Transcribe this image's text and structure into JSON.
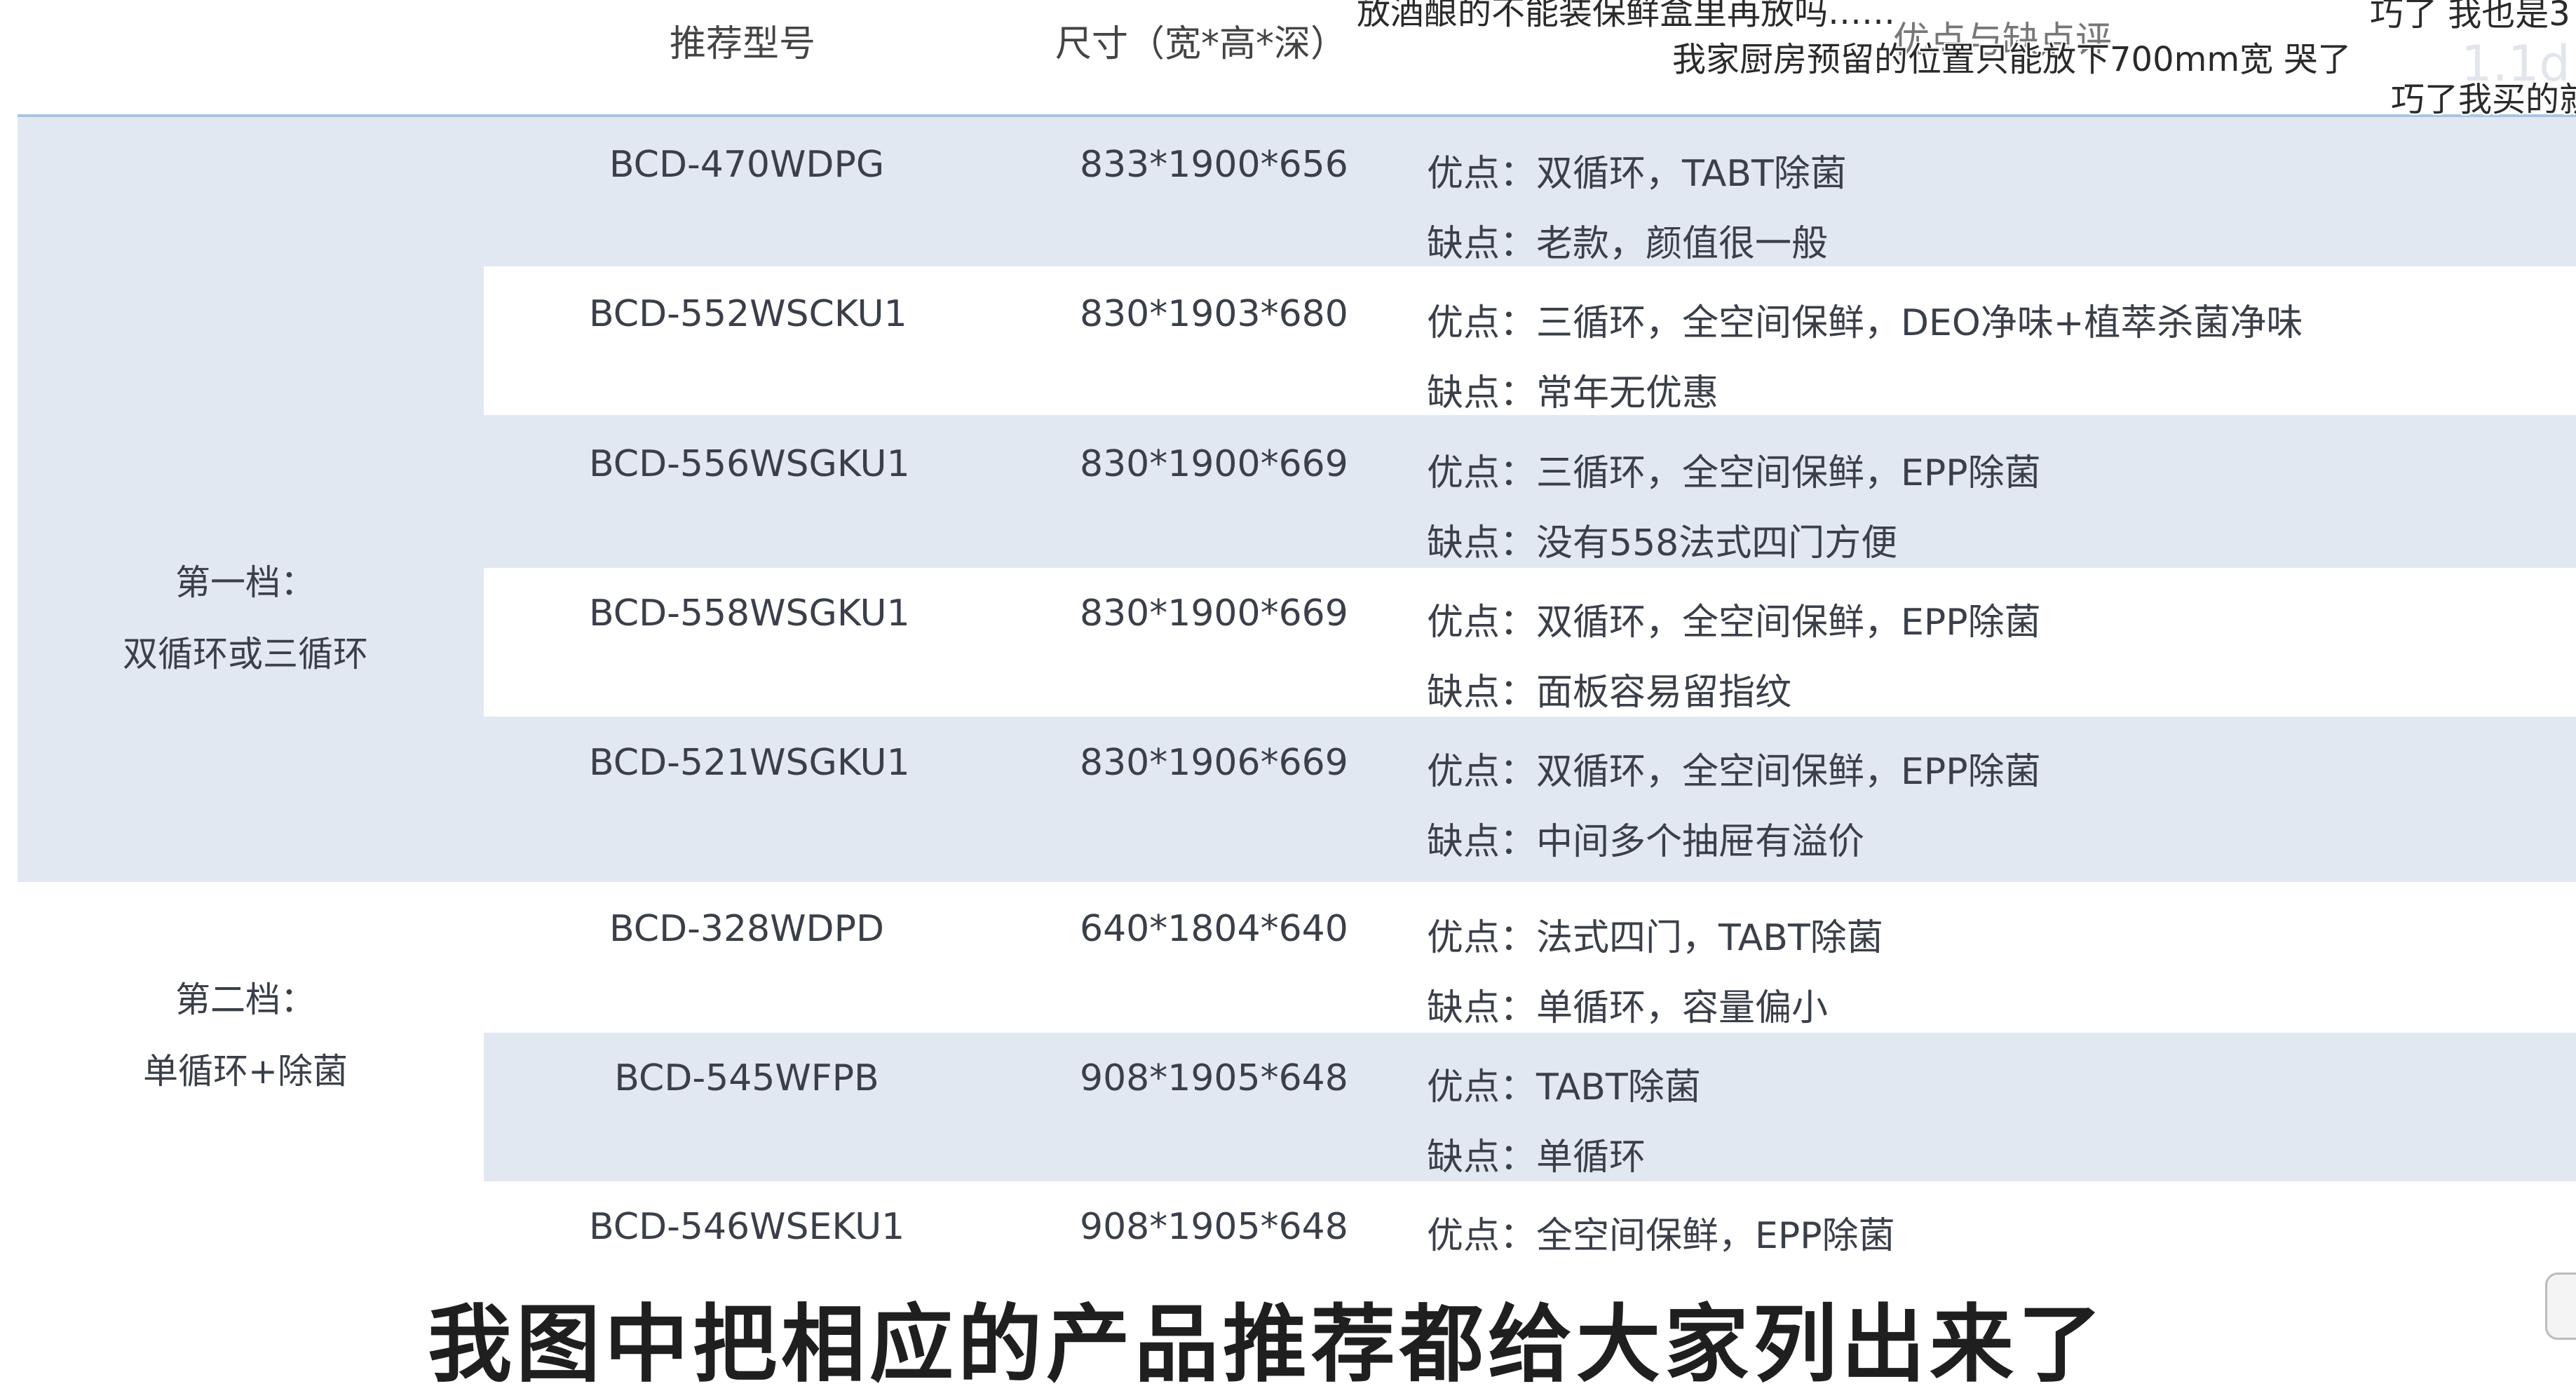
{
  "header": {
    "model": "推荐型号",
    "size": "尺寸（宽*高*深）",
    "review": "优点与缺点评"
  },
  "tiers": [
    {
      "name": "第一档：",
      "desc": "双循环或三循环"
    },
    {
      "name": "第二档：",
      "desc": "单循环+除菌"
    }
  ],
  "rows": [
    {
      "model": "BCD-470WDPG",
      "size": "833*1900*656",
      "pro": "优点：双循环，TABT除菌",
      "con": "缺点：老款，颜值很一般"
    },
    {
      "model": "BCD-552WSCKU1",
      "size": "830*1903*680",
      "pro": "优点：三循环，全空间保鲜，DEO净味+植萃杀菌净味",
      "con": "缺点：常年无优惠"
    },
    {
      "model": "BCD-556WSGKU1",
      "size": "830*1900*669",
      "pro": "优点：三循环，全空间保鲜，EPP除菌",
      "con": "缺点：没有558法式四门方便"
    },
    {
      "model": "BCD-558WSGKU1",
      "size": "830*1900*669",
      "pro": "优点：双循环，全空间保鲜，EPP除菌",
      "con": "缺点：面板容易留指纹"
    },
    {
      "model": "BCD-521WSGKU1",
      "size": "830*1906*669",
      "pro": "优点：双循环，全空间保鲜，EPP除菌",
      "con": "缺点：中间多个抽屉有溢价"
    },
    {
      "model": "BCD-328WDPD",
      "size": "640*1804*640",
      "pro": "优点：法式四门，TABT除菌",
      "con": "缺点：单循环，容量偏小"
    },
    {
      "model": "BCD-545WFPB",
      "size": "908*1905*648",
      "pro": "优点：TABT除菌",
      "con": "缺点：单循环"
    },
    {
      "model": "BCD-546WSEKU1",
      "size": "908*1905*648",
      "pro": "优点：全空间保鲜，EPP除菌",
      "con": ""
    }
  ],
  "danmaku": [
    "放酒酿的不能装保鲜盒里再放吗……",
    "我家厨房预留的位置只能放下700mm宽 哭了",
    "巧了 我也是3",
    "巧了我买的就"
  ],
  "subtitle": "我图中把相应的产品推荐都给大家列出来了",
  "watermark": "1.1d"
}
